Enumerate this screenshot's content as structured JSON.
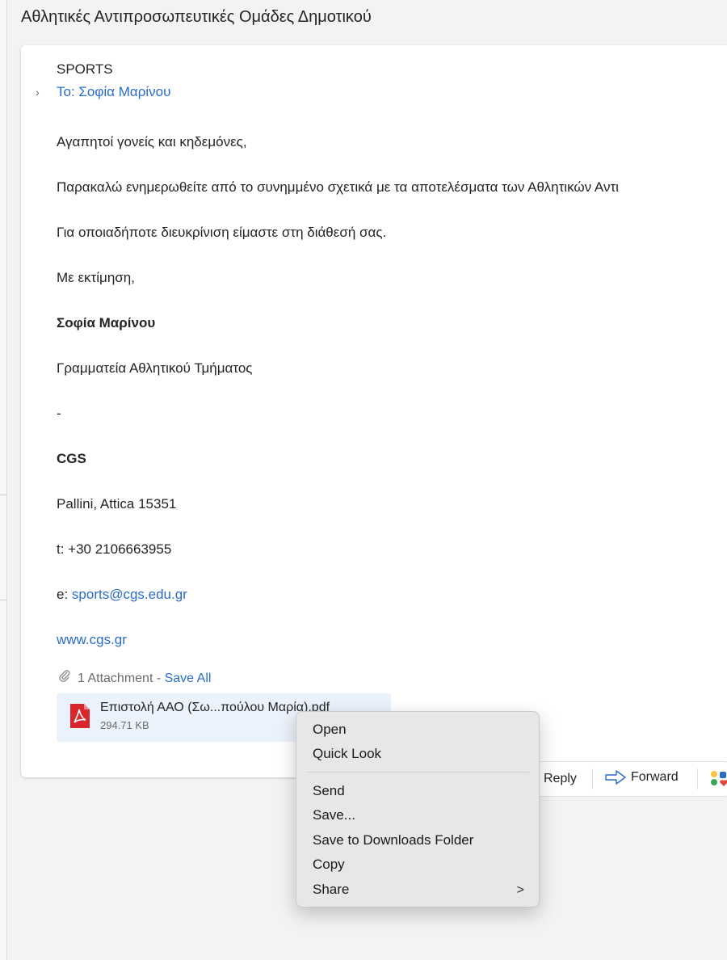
{
  "subject": "Αθλητικές Αντιπροσωπευτικές Ομάδες Δημοτικού",
  "message": {
    "sender": "SPORTS",
    "to": "To: Σοφία Μαρίνου",
    "greeting": "Αγαπητοί γονείς και κηδεμόνες,",
    "paragraph1": "Παρακαλώ ενημερωθείτε από το συνημμένο σχετικά με τα αποτελέσματα των Αθλητικών Αντι",
    "paragraph2": "Για οποιαδήποτε διευκρίνιση είμαστε στη διάθεσή σας.",
    "closing": "Με εκτίμηση,",
    "signature_name": "Σοφία Μαρίνου",
    "signature_dept": "Γραμματεία Αθλητικού Τμήματος",
    "dash": "-",
    "org": "CGS",
    "address": "Pallini, Attica 15351",
    "phone": "t: +30 2106663955",
    "email_prefix": "e: ",
    "email": "sports@cgs.edu.gr",
    "website": "www.cgs.gr"
  },
  "attachments": {
    "count_label": "1 Attachment - ",
    "save_all": "Save All",
    "file": {
      "name": "Επιστολή ΑΑΟ (Σω...πούλου Μαρία).pdf",
      "size": "294.71 KB",
      "icon": "pdf-icon"
    }
  },
  "actions": {
    "reply": "Reply",
    "forward": "Forward"
  },
  "context_menu": {
    "items": [
      "Open",
      "Quick Look",
      "Send",
      "Save...",
      "Save to Downloads Folder",
      "Copy",
      "Share"
    ],
    "share_arrow": ">"
  },
  "colors": {
    "link": "#2a6cc9",
    "attachment_bg": "#eaf2fc",
    "pdf_red": "#d9262c",
    "menu_bg": "#e7e7e7"
  }
}
